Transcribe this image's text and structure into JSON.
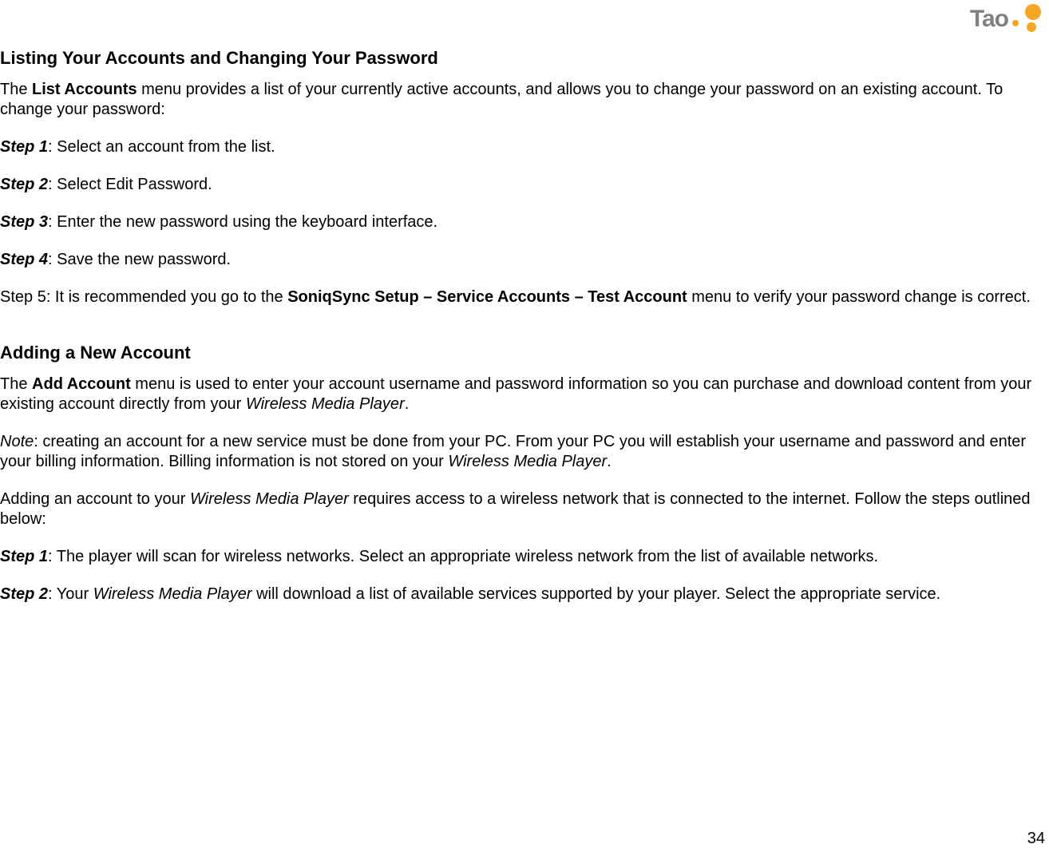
{
  "logo": {
    "text": "Tao"
  },
  "section1": {
    "heading": "Listing Your Accounts and Changing Your Password",
    "intro_pre": "The ",
    "intro_bold": "List Accounts",
    "intro_post": " menu provides a list of your currently active accounts, and allows you to change your password on an existing account.  To change your password:",
    "step1_label": "Step 1",
    "step1_text": ": Select an account from the list.",
    "step2_label": "Step 2",
    "step2_text": ": Select Edit Password.",
    "step3_label": "Step 3",
    "step3_text": ": Enter the new password using the keyboard interface.",
    "step4_label": "Step 4",
    "step4_text": ": Save the new password.",
    "step5_pre": "Step 5: It is recommended you go to the ",
    "step5_bold": "SoniqSync Setup – Service Accounts – Test Account",
    "step5_post": " menu to verify your password change is correct."
  },
  "section2": {
    "heading": "Adding a New Account",
    "intro_pre": "The ",
    "intro_bold": "Add Account",
    "intro_mid": " menu is used to enter your account username and password information so you can purchase and download content from your existing account directly from your ",
    "intro_italic": "Wireless Media Player",
    "intro_post": ".",
    "note_label": "Note",
    "note_mid": ": creating an account for a new service must be done from your PC.  From your PC you will establish your username and password and enter your billing information.  Billing information is not stored on your ",
    "note_italic": "Wireless Media Player",
    "note_post": ".",
    "para3_pre": "Adding an account to your ",
    "para3_italic": "Wireless Media Player",
    "para3_post": " requires access to a wireless network that is connected to the internet.  Follow the steps outlined below:",
    "step1_label": "Step 1",
    "step1_text": ": The player will scan for wireless networks.  Select an appropriate wireless network from the list of available networks.",
    "step2_label": "Step 2",
    "step2_pre": ": Your ",
    "step2_italic": "Wireless Media Player",
    "step2_post": " will download a list of available services supported by your player.  Select the appropriate service."
  },
  "page_number": "34"
}
